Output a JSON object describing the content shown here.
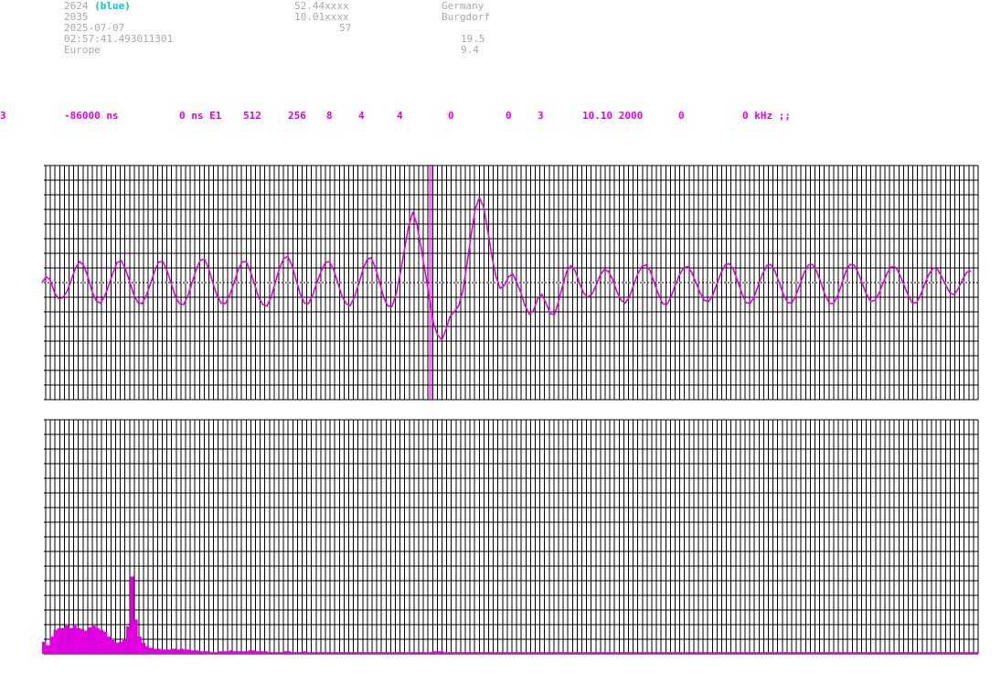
{
  "header": {
    "station_id": "2624",
    "station_color": "(blue)",
    "code": "2035",
    "date": "2025-07-07",
    "time": "02:57:41.493011301",
    "region": "Europe",
    "latitude": "52.44xxxx",
    "longitude": "10.01xxxx",
    "altitude": "57",
    "country": "Germany",
    "city": "Burgdorf",
    "value_a": "19.5",
    "value_b": "9.4"
  },
  "params": [
    "3",
    "-86000 ns",
    "0 ns E1",
    "512",
    "256",
    "8",
    "4",
    "4",
    "0",
    "0",
    "3",
    "10.10 2000",
    "0",
    "0 kHz ;;"
  ],
  "colors": {
    "signal": "#e000e0",
    "grid": "#000000",
    "baseline": "#ffffff",
    "header_text": "#a9a9a9",
    "accent_blue": "#00c8c8"
  },
  "chart_data": [
    {
      "type": "line",
      "grid": true,
      "samples": [
        0,
        20,
        8,
        -35,
        -55,
        -52,
        -30,
        8,
        48,
        72,
        58,
        20,
        -30,
        -62,
        -70,
        -48,
        -10,
        32,
        68,
        75,
        48,
        5,
        -40,
        -68,
        -72,
        -45,
        -5,
        38,
        70,
        72,
        42,
        -2,
        -48,
        -72,
        -75,
        -45,
        -2,
        45,
        76,
        80,
        48,
        0,
        -45,
        -70,
        -72,
        -45,
        -5,
        40,
        70,
        72,
        40,
        -5,
        -50,
        -75,
        -80,
        -50,
        0,
        48,
        82,
        90,
        58,
        10,
        -40,
        -70,
        -72,
        -42,
        0,
        38,
        68,
        72,
        45,
        0,
        -45,
        -72,
        -78,
        -50,
        -5,
        42,
        78,
        85,
        52,
        5,
        -50,
        -80,
        -82,
        -40,
        30,
        112,
        190,
        240,
        200,
        120,
        35,
        -55,
        -140,
        -180,
        -195,
        -160,
        -115,
        -100,
        -80,
        -30,
        60,
        160,
        250,
        290,
        260,
        180,
        90,
        20,
        -20,
        -10,
        20,
        30,
        0,
        -35,
        -80,
        -108,
        -95,
        -55,
        -40,
        -70,
        -105,
        -110,
        -65,
        -10,
        40,
        58,
        40,
        0,
        -35,
        -50,
        -40,
        -10,
        25,
        45,
        38,
        10,
        -30,
        -60,
        -70,
        -50,
        -10,
        28,
        55,
        60,
        40,
        0,
        -40,
        -72,
        -75,
        -50,
        -10,
        25,
        50,
        55,
        35,
        0,
        -35,
        -60,
        -65,
        -45,
        -5,
        32,
        60,
        65,
        45,
        5,
        -35,
        -68,
        -72,
        -48,
        -8,
        30,
        58,
        62,
        38,
        0,
        -40,
        -68,
        -70,
        -45,
        -5,
        35,
        60,
        62,
        38,
        0,
        -42,
        -70,
        -72,
        -45,
        -5,
        38,
        62,
        60,
        32,
        -5,
        -42,
        -65,
        -60,
        -35,
        0,
        35,
        55,
        52,
        25,
        -10,
        -45,
        -70,
        -68,
        -40,
        -2,
        30,
        50,
        45,
        20,
        -10,
        -35,
        -42,
        -20,
        10,
        35,
        40
      ]
    },
    {
      "type": "bar",
      "grid": true,
      "values": [
        14,
        10,
        20,
        28,
        30,
        30,
        33,
        30,
        33,
        30,
        29,
        27,
        31,
        33,
        30,
        28,
        26,
        20,
        16,
        13,
        14,
        16,
        32,
        90,
        40,
        20,
        13,
        9,
        7,
        6,
        6,
        5,
        5,
        5,
        6,
        5,
        6,
        5,
        5,
        4,
        4,
        3,
        3,
        3,
        2,
        2,
        3,
        3,
        3,
        4,
        3,
        3,
        3,
        3,
        4,
        4,
        3,
        3,
        3,
        2,
        2,
        2,
        2,
        3,
        3,
        2,
        2,
        2,
        3,
        2,
        2,
        2,
        2,
        2,
        2,
        2,
        2,
        2,
        2,
        2,
        2,
        2,
        2,
        2,
        2,
        2,
        2,
        2,
        2,
        2,
        2,
        2,
        2,
        2,
        2,
        2,
        2,
        2,
        2,
        2,
        2,
        2,
        3,
        3,
        3,
        2,
        2,
        2,
        2,
        2,
        2,
        2,
        2,
        2,
        2,
        2,
        2,
        2,
        2,
        2,
        2,
        2,
        2,
        2,
        2,
        2,
        2,
        2,
        2,
        2,
        2,
        2,
        2,
        2,
        2,
        2,
        2,
        2,
        2,
        2,
        2,
        2,
        2,
        2,
        2,
        2,
        2,
        2,
        2,
        2,
        2,
        2,
        2,
        2,
        2,
        2,
        2,
        2,
        2,
        2,
        2,
        2,
        2,
        2,
        2,
        2,
        2,
        2,
        2,
        2,
        2,
        2,
        2,
        2,
        2,
        2,
        2,
        2,
        2,
        2,
        2,
        2,
        2,
        2,
        2,
        2,
        2,
        2,
        2,
        2,
        2,
        2,
        2,
        2,
        2,
        2,
        2,
        2,
        2,
        2,
        2,
        2,
        2,
        2,
        2,
        2,
        2,
        2,
        2,
        2,
        2,
        2,
        2,
        2,
        2,
        2,
        2,
        2,
        2,
        2,
        2,
        2,
        2,
        2,
        2,
        2,
        2,
        2,
        2,
        2,
        2,
        2,
        2,
        2,
        2,
        2,
        2,
        2,
        2,
        2,
        2,
        2,
        2,
        2,
        2
      ]
    }
  ]
}
